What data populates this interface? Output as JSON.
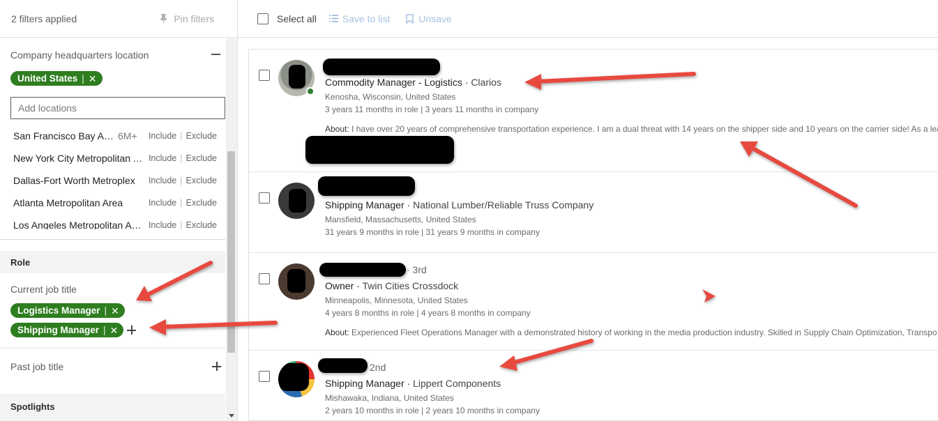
{
  "filters_header": {
    "count_label": "2 filters applied",
    "pin_label": "Pin filters"
  },
  "hq": {
    "title": "Company headquarters location",
    "pill_label": "United States",
    "input_placeholder": "Add locations",
    "include_label": "Include",
    "exclude_label": "Exclude",
    "locations": [
      {
        "name": "San Francisco Bay Area",
        "count": "6M+"
      },
      {
        "name": "New York City Metropolitan Area",
        "count": ""
      },
      {
        "name": "Dallas-Fort Worth Metroplex",
        "count": ""
      },
      {
        "name": "Atlanta Metropolitan Area",
        "count": ""
      },
      {
        "name": "Los Angeles Metropolitan Area",
        "count": ""
      }
    ]
  },
  "role": {
    "band_label": "Role",
    "current_title_label": "Current job title",
    "pills": [
      "Logistics Manager",
      "Shipping Manager"
    ],
    "past_title_label": "Past job title"
  },
  "spotlights": {
    "band_label": "Spotlights"
  },
  "toolbar": {
    "select_all": "Select all",
    "save_to_list": "Save to list",
    "unsave": "Unsave"
  },
  "results": [
    {
      "headline": "Commodity Manager - Logistics",
      "company": "Clarios",
      "location": "Kenosha, Wisconsin, United States",
      "tenure": "3 years 11 months in role | 3 years 11 months in company",
      "about_label": "About:",
      "about": "I have over 20 years of comprehensive transportation experience. I am a dual threat with 14 years on the shipper side and 10 years on the carrier side! As a lead",
      "degree": ""
    },
    {
      "headline": "Shipping Manager",
      "company": "National Lumber/Reliable Truss Company",
      "location": "Mansfield, Massachusetts, United States",
      "tenure": "31 years 9 months in role | 31 years 9 months in company",
      "about_label": "",
      "about": "",
      "degree": ""
    },
    {
      "headline": "Owner",
      "company": "Twin Cities Crossdock",
      "location": "Minneapolis, Minnesota, United States",
      "tenure": "4 years 8 months in role | 4 years 8 months in company",
      "about_label": "About:",
      "about": "Experienced Fleet Operations Manager with a demonstrated history of working in the media production industry. Skilled in Supply Chain Optimization, Transpo",
      "degree": "· 3rd"
    },
    {
      "headline": "Shipping Manager",
      "company": "Lippert Components",
      "location": "Mishawaka, Indiana, United States",
      "tenure": "2 years 10 months in role | 2 years 10 months in company",
      "about_label": "",
      "about": "",
      "degree": "2nd"
    }
  ],
  "colors": {
    "pill_green": "#2e7d1f",
    "annotation_red": "#e8493f",
    "link_disabled": "#a7c2e0"
  }
}
